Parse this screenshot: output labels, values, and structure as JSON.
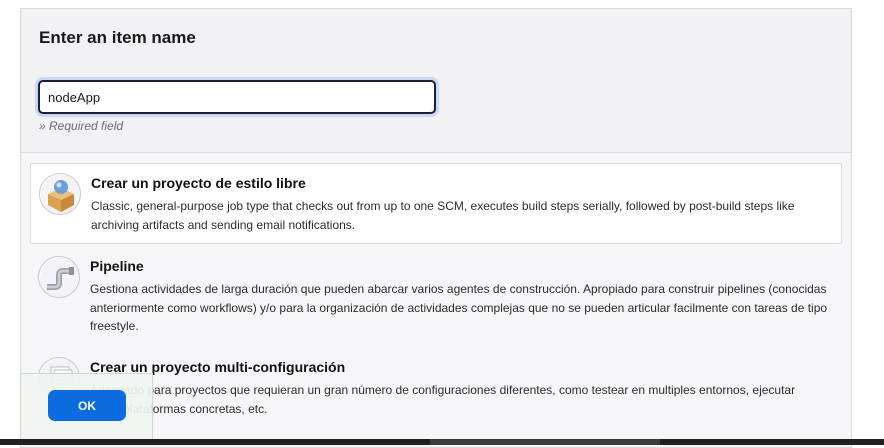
{
  "form": {
    "title": "Enter an item name",
    "name_value": "nodeApp",
    "required_hint": "» Required field"
  },
  "item_types": [
    {
      "title": "Crear un proyecto de estilo libre",
      "description": "Classic, general-purpose job type that checks out from up to one SCM, executes build steps serially, followed by post-build steps like archiving artifacts and sending email notifications.",
      "icon": "freestyle-box-icon",
      "selected": true
    },
    {
      "title": "Pipeline",
      "description": "Gestiona actividades de larga duración que pueden abarcar varios agentes de construcción. Apropiado para construir pipelines (conocidas anteriormente como workflows) y/o para la organización de actividades complejas que no se pueden articular facilmente con tareas de tipo freestyle.",
      "icon": "pipeline-icon",
      "selected": false
    },
    {
      "title": "Crear un proyecto multi-configuración",
      "description": "Adecuado para proyectos que requieran un gran número de configuraciones diferentes, como testear en multiples entornos, ejecutar sobre plataformas concretas, etc.",
      "icon": "multi-config-icon",
      "selected": false
    }
  ],
  "actions": {
    "ok_label": "OK"
  },
  "colors": {
    "accent": "#0b6bdf",
    "panel_bg": "#f6f6f8",
    "input_border": "#1b1f3a"
  }
}
